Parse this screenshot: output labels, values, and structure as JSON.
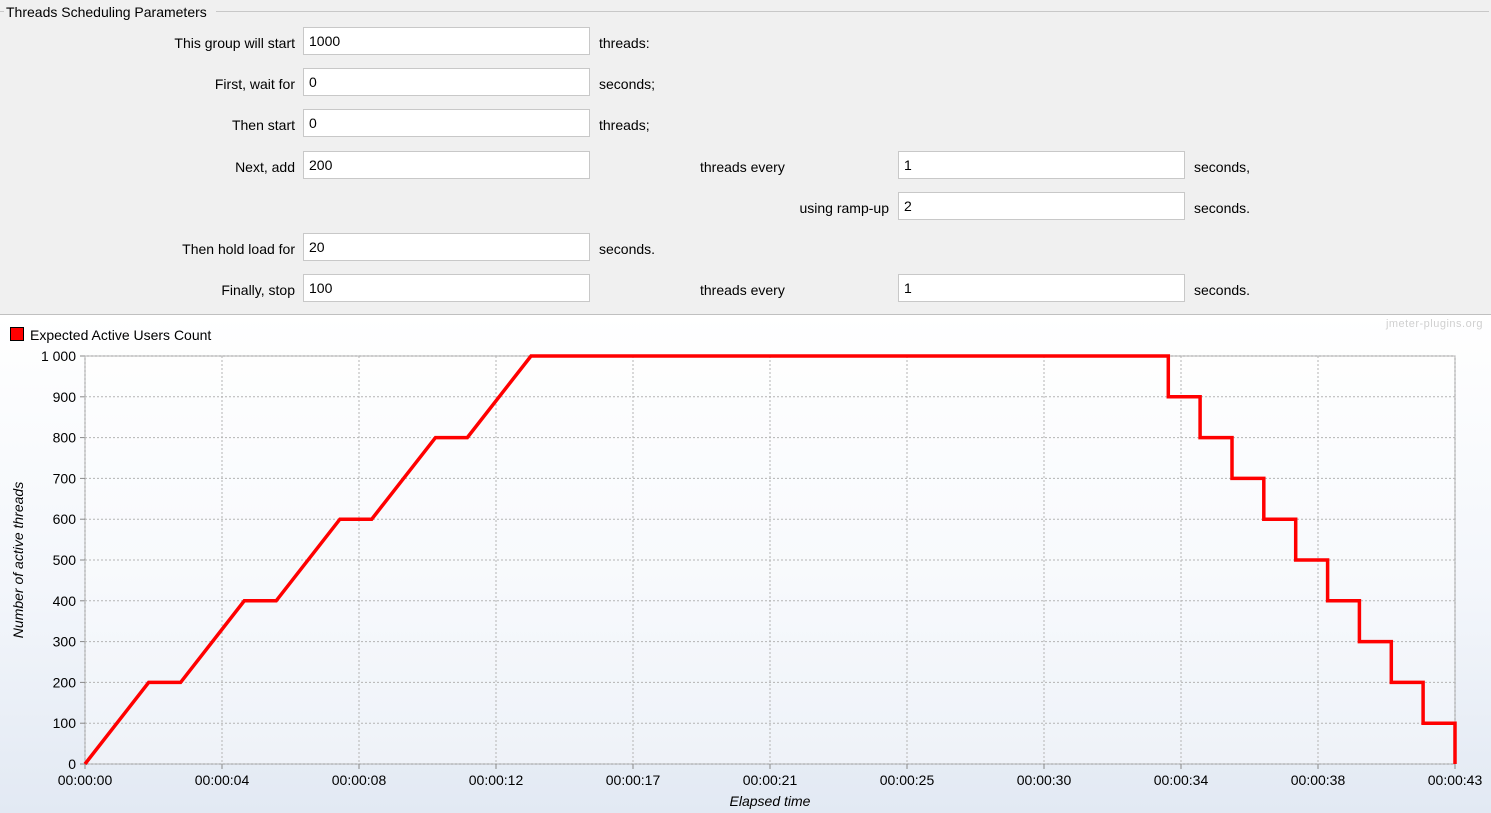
{
  "panel": {
    "title": "Threads Scheduling Parameters"
  },
  "form": {
    "start_label": "This group will start",
    "start_value": "1000",
    "start_unit": "threads:",
    "wait_label": "First, wait for",
    "wait_value": "0",
    "wait_unit": "seconds;",
    "then_start_label": "Then start",
    "then_start_value": "0",
    "then_start_unit": "threads;",
    "next_add_label": "Next, add",
    "next_add_value": "200",
    "next_add_every_label": "threads every",
    "next_add_every_value": "1",
    "next_add_every_unit": "seconds,",
    "rampup_label": "using ramp-up",
    "rampup_value": "2",
    "rampup_unit": "seconds.",
    "hold_label": "Then hold load for",
    "hold_value": "20",
    "hold_unit": "seconds.",
    "stop_label": "Finally, stop",
    "stop_value": "100",
    "stop_every_label": "threads every",
    "stop_every_value": "1",
    "stop_every_unit": "seconds."
  },
  "chart": {
    "watermark": "jmeter-plugins.org",
    "legend_color": "#ff0000"
  },
  "chart_data": {
    "type": "line",
    "title": "",
    "xlabel": "Elapsed time",
    "ylabel": "Number of active threads",
    "xlim": [
      0,
      43
    ],
    "ylim": [
      0,
      1000
    ],
    "grid": true,
    "legend_position": "top-left",
    "x_tick_labels": [
      "00:00:00",
      "00:00:04",
      "00:00:08",
      "00:00:12",
      "00:00:17",
      "00:00:21",
      "00:00:25",
      "00:00:30",
      "00:00:34",
      "00:00:38",
      "00:00:43"
    ],
    "x_ticks_seconds": [
      0,
      4.3,
      8.6,
      12.9,
      17.2,
      21.5,
      25.8,
      30.1,
      34.4,
      38.7,
      43
    ],
    "y_tick_labels": [
      "0",
      "100",
      "200",
      "300",
      "400",
      "500",
      "600",
      "700",
      "800",
      "900",
      "1 000"
    ],
    "y_ticks": [
      0,
      100,
      200,
      300,
      400,
      500,
      600,
      700,
      800,
      900,
      1000
    ],
    "series": [
      {
        "name": "Expected Active Users Count",
        "color": "#ff0000",
        "points": [
          [
            0,
            0
          ],
          [
            2,
            200
          ],
          [
            3,
            200
          ],
          [
            5,
            400
          ],
          [
            6,
            400
          ],
          [
            8,
            600
          ],
          [
            9,
            600
          ],
          [
            11,
            800
          ],
          [
            12,
            800
          ],
          [
            14,
            1000
          ],
          [
            34,
            1000
          ],
          [
            34,
            900
          ],
          [
            35,
            900
          ],
          [
            35,
            800
          ],
          [
            36,
            800
          ],
          [
            36,
            700
          ],
          [
            37,
            700
          ],
          [
            37,
            600
          ],
          [
            38,
            600
          ],
          [
            38,
            500
          ],
          [
            39,
            500
          ],
          [
            39,
            400
          ],
          [
            40,
            400
          ],
          [
            40,
            300
          ],
          [
            41,
            300
          ],
          [
            41,
            200
          ],
          [
            42,
            200
          ],
          [
            42,
            100
          ],
          [
            43,
            100
          ],
          [
            43,
            0
          ]
        ]
      }
    ]
  }
}
